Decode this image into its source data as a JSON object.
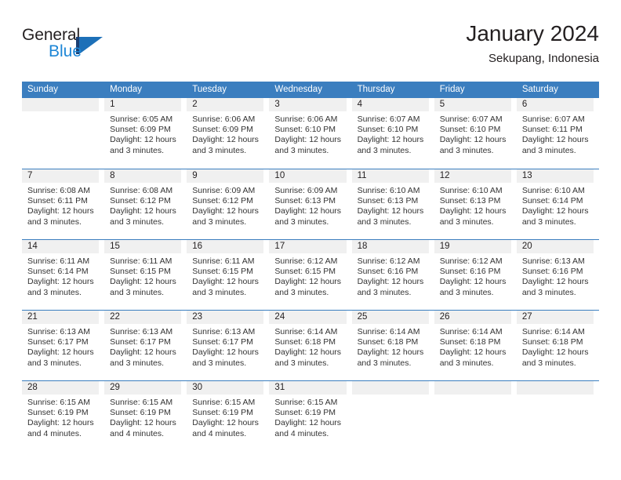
{
  "brand": {
    "name_top": "General",
    "name_bottom": "Blue",
    "mark": "triangle-logo"
  },
  "header": {
    "title": "January 2024",
    "subtitle": "Sekupang, Indonesia"
  },
  "colors": {
    "header_blue": "#3b7ebf",
    "brand_blue": "#1d86d6",
    "brand_dark": "#1b3f73",
    "day_band": "#f0f0f0",
    "text": "#231f20"
  },
  "weekdays": [
    "Sunday",
    "Monday",
    "Tuesday",
    "Wednesday",
    "Thursday",
    "Friday",
    "Saturday"
  ],
  "weeks": [
    [
      {
        "day": "",
        "sunrise": "",
        "sunset": "",
        "daylight_1": "",
        "daylight_2": ""
      },
      {
        "day": "1",
        "sunrise": "Sunrise: 6:05 AM",
        "sunset": "Sunset: 6:09 PM",
        "daylight_1": "Daylight: 12 hours",
        "daylight_2": "and 3 minutes."
      },
      {
        "day": "2",
        "sunrise": "Sunrise: 6:06 AM",
        "sunset": "Sunset: 6:09 PM",
        "daylight_1": "Daylight: 12 hours",
        "daylight_2": "and 3 minutes."
      },
      {
        "day": "3",
        "sunrise": "Sunrise: 6:06 AM",
        "sunset": "Sunset: 6:10 PM",
        "daylight_1": "Daylight: 12 hours",
        "daylight_2": "and 3 minutes."
      },
      {
        "day": "4",
        "sunrise": "Sunrise: 6:07 AM",
        "sunset": "Sunset: 6:10 PM",
        "daylight_1": "Daylight: 12 hours",
        "daylight_2": "and 3 minutes."
      },
      {
        "day": "5",
        "sunrise": "Sunrise: 6:07 AM",
        "sunset": "Sunset: 6:10 PM",
        "daylight_1": "Daylight: 12 hours",
        "daylight_2": "and 3 minutes."
      },
      {
        "day": "6",
        "sunrise": "Sunrise: 6:07 AM",
        "sunset": "Sunset: 6:11 PM",
        "daylight_1": "Daylight: 12 hours",
        "daylight_2": "and 3 minutes."
      }
    ],
    [
      {
        "day": "7",
        "sunrise": "Sunrise: 6:08 AM",
        "sunset": "Sunset: 6:11 PM",
        "daylight_1": "Daylight: 12 hours",
        "daylight_2": "and 3 minutes."
      },
      {
        "day": "8",
        "sunrise": "Sunrise: 6:08 AM",
        "sunset": "Sunset: 6:12 PM",
        "daylight_1": "Daylight: 12 hours",
        "daylight_2": "and 3 minutes."
      },
      {
        "day": "9",
        "sunrise": "Sunrise: 6:09 AM",
        "sunset": "Sunset: 6:12 PM",
        "daylight_1": "Daylight: 12 hours",
        "daylight_2": "and 3 minutes."
      },
      {
        "day": "10",
        "sunrise": "Sunrise: 6:09 AM",
        "sunset": "Sunset: 6:13 PM",
        "daylight_1": "Daylight: 12 hours",
        "daylight_2": "and 3 minutes."
      },
      {
        "day": "11",
        "sunrise": "Sunrise: 6:10 AM",
        "sunset": "Sunset: 6:13 PM",
        "daylight_1": "Daylight: 12 hours",
        "daylight_2": "and 3 minutes."
      },
      {
        "day": "12",
        "sunrise": "Sunrise: 6:10 AM",
        "sunset": "Sunset: 6:13 PM",
        "daylight_1": "Daylight: 12 hours",
        "daylight_2": "and 3 minutes."
      },
      {
        "day": "13",
        "sunrise": "Sunrise: 6:10 AM",
        "sunset": "Sunset: 6:14 PM",
        "daylight_1": "Daylight: 12 hours",
        "daylight_2": "and 3 minutes."
      }
    ],
    [
      {
        "day": "14",
        "sunrise": "Sunrise: 6:11 AM",
        "sunset": "Sunset: 6:14 PM",
        "daylight_1": "Daylight: 12 hours",
        "daylight_2": "and 3 minutes."
      },
      {
        "day": "15",
        "sunrise": "Sunrise: 6:11 AM",
        "sunset": "Sunset: 6:15 PM",
        "daylight_1": "Daylight: 12 hours",
        "daylight_2": "and 3 minutes."
      },
      {
        "day": "16",
        "sunrise": "Sunrise: 6:11 AM",
        "sunset": "Sunset: 6:15 PM",
        "daylight_1": "Daylight: 12 hours",
        "daylight_2": "and 3 minutes."
      },
      {
        "day": "17",
        "sunrise": "Sunrise: 6:12 AM",
        "sunset": "Sunset: 6:15 PM",
        "daylight_1": "Daylight: 12 hours",
        "daylight_2": "and 3 minutes."
      },
      {
        "day": "18",
        "sunrise": "Sunrise: 6:12 AM",
        "sunset": "Sunset: 6:16 PM",
        "daylight_1": "Daylight: 12 hours",
        "daylight_2": "and 3 minutes."
      },
      {
        "day": "19",
        "sunrise": "Sunrise: 6:12 AM",
        "sunset": "Sunset: 6:16 PM",
        "daylight_1": "Daylight: 12 hours",
        "daylight_2": "and 3 minutes."
      },
      {
        "day": "20",
        "sunrise": "Sunrise: 6:13 AM",
        "sunset": "Sunset: 6:16 PM",
        "daylight_1": "Daylight: 12 hours",
        "daylight_2": "and 3 minutes."
      }
    ],
    [
      {
        "day": "21",
        "sunrise": "Sunrise: 6:13 AM",
        "sunset": "Sunset: 6:17 PM",
        "daylight_1": "Daylight: 12 hours",
        "daylight_2": "and 3 minutes."
      },
      {
        "day": "22",
        "sunrise": "Sunrise: 6:13 AM",
        "sunset": "Sunset: 6:17 PM",
        "daylight_1": "Daylight: 12 hours",
        "daylight_2": "and 3 minutes."
      },
      {
        "day": "23",
        "sunrise": "Sunrise: 6:13 AM",
        "sunset": "Sunset: 6:17 PM",
        "daylight_1": "Daylight: 12 hours",
        "daylight_2": "and 3 minutes."
      },
      {
        "day": "24",
        "sunrise": "Sunrise: 6:14 AM",
        "sunset": "Sunset: 6:18 PM",
        "daylight_1": "Daylight: 12 hours",
        "daylight_2": "and 3 minutes."
      },
      {
        "day": "25",
        "sunrise": "Sunrise: 6:14 AM",
        "sunset": "Sunset: 6:18 PM",
        "daylight_1": "Daylight: 12 hours",
        "daylight_2": "and 3 minutes."
      },
      {
        "day": "26",
        "sunrise": "Sunrise: 6:14 AM",
        "sunset": "Sunset: 6:18 PM",
        "daylight_1": "Daylight: 12 hours",
        "daylight_2": "and 3 minutes."
      },
      {
        "day": "27",
        "sunrise": "Sunrise: 6:14 AM",
        "sunset": "Sunset: 6:18 PM",
        "daylight_1": "Daylight: 12 hours",
        "daylight_2": "and 3 minutes."
      }
    ],
    [
      {
        "day": "28",
        "sunrise": "Sunrise: 6:15 AM",
        "sunset": "Sunset: 6:19 PM",
        "daylight_1": "Daylight: 12 hours",
        "daylight_2": "and 4 minutes."
      },
      {
        "day": "29",
        "sunrise": "Sunrise: 6:15 AM",
        "sunset": "Sunset: 6:19 PM",
        "daylight_1": "Daylight: 12 hours",
        "daylight_2": "and 4 minutes."
      },
      {
        "day": "30",
        "sunrise": "Sunrise: 6:15 AM",
        "sunset": "Sunset: 6:19 PM",
        "daylight_1": "Daylight: 12 hours",
        "daylight_2": "and 4 minutes."
      },
      {
        "day": "31",
        "sunrise": "Sunrise: 6:15 AM",
        "sunset": "Sunset: 6:19 PM",
        "daylight_1": "Daylight: 12 hours",
        "daylight_2": "and 4 minutes."
      },
      {
        "day": "",
        "sunrise": "",
        "sunset": "",
        "daylight_1": "",
        "daylight_2": ""
      },
      {
        "day": "",
        "sunrise": "",
        "sunset": "",
        "daylight_1": "",
        "daylight_2": ""
      },
      {
        "day": "",
        "sunrise": "",
        "sunset": "",
        "daylight_1": "",
        "daylight_2": ""
      }
    ]
  ]
}
